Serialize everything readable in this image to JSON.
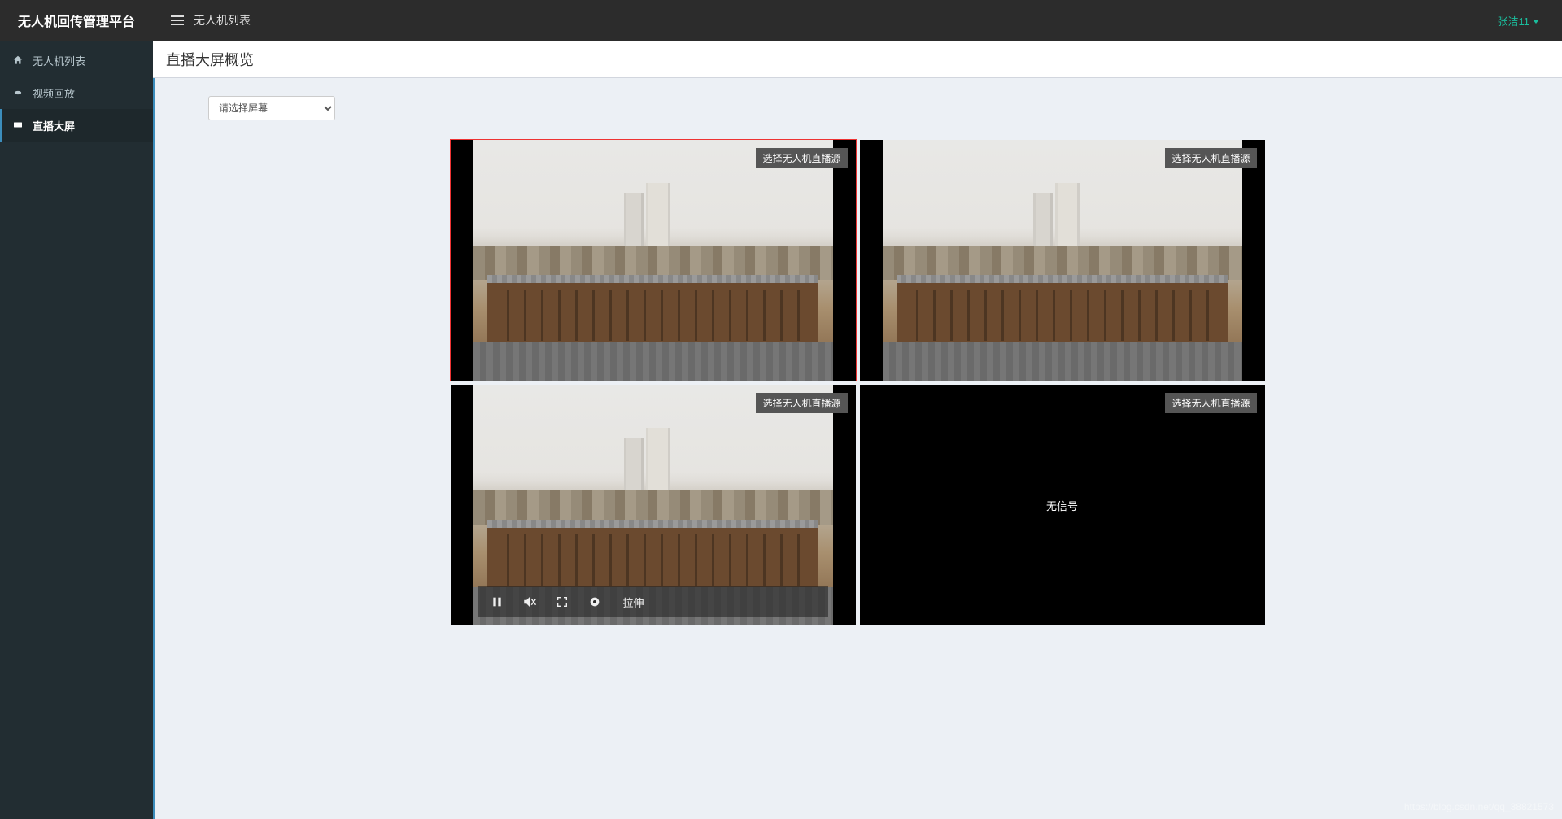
{
  "brand": "无人机回传管理平台",
  "header_breadcrumb": "无人机列表",
  "user_name": "张洁11",
  "sidebar": {
    "items": [
      {
        "label": "无人机列表",
        "icon": "home-icon"
      },
      {
        "label": "视频回放",
        "icon": "video-icon"
      },
      {
        "label": "直播大屏",
        "icon": "screen-icon"
      }
    ],
    "active_index": 2
  },
  "page_title": "直播大屏概览",
  "select_placeholder": "请选择屏幕",
  "source_button_label": "选择无人机直播源",
  "no_signal_label": "无信号",
  "player_controls": {
    "scale_label": "拉伸"
  },
  "tiles": [
    {
      "has_video": true,
      "selected": true,
      "show_controls": false
    },
    {
      "has_video": true,
      "selected": false,
      "show_controls": false
    },
    {
      "has_video": true,
      "selected": false,
      "show_controls": true
    },
    {
      "has_video": false,
      "selected": false,
      "show_controls": false
    }
  ],
  "watermark": "https://blog.csdn.net/qq_38821573"
}
